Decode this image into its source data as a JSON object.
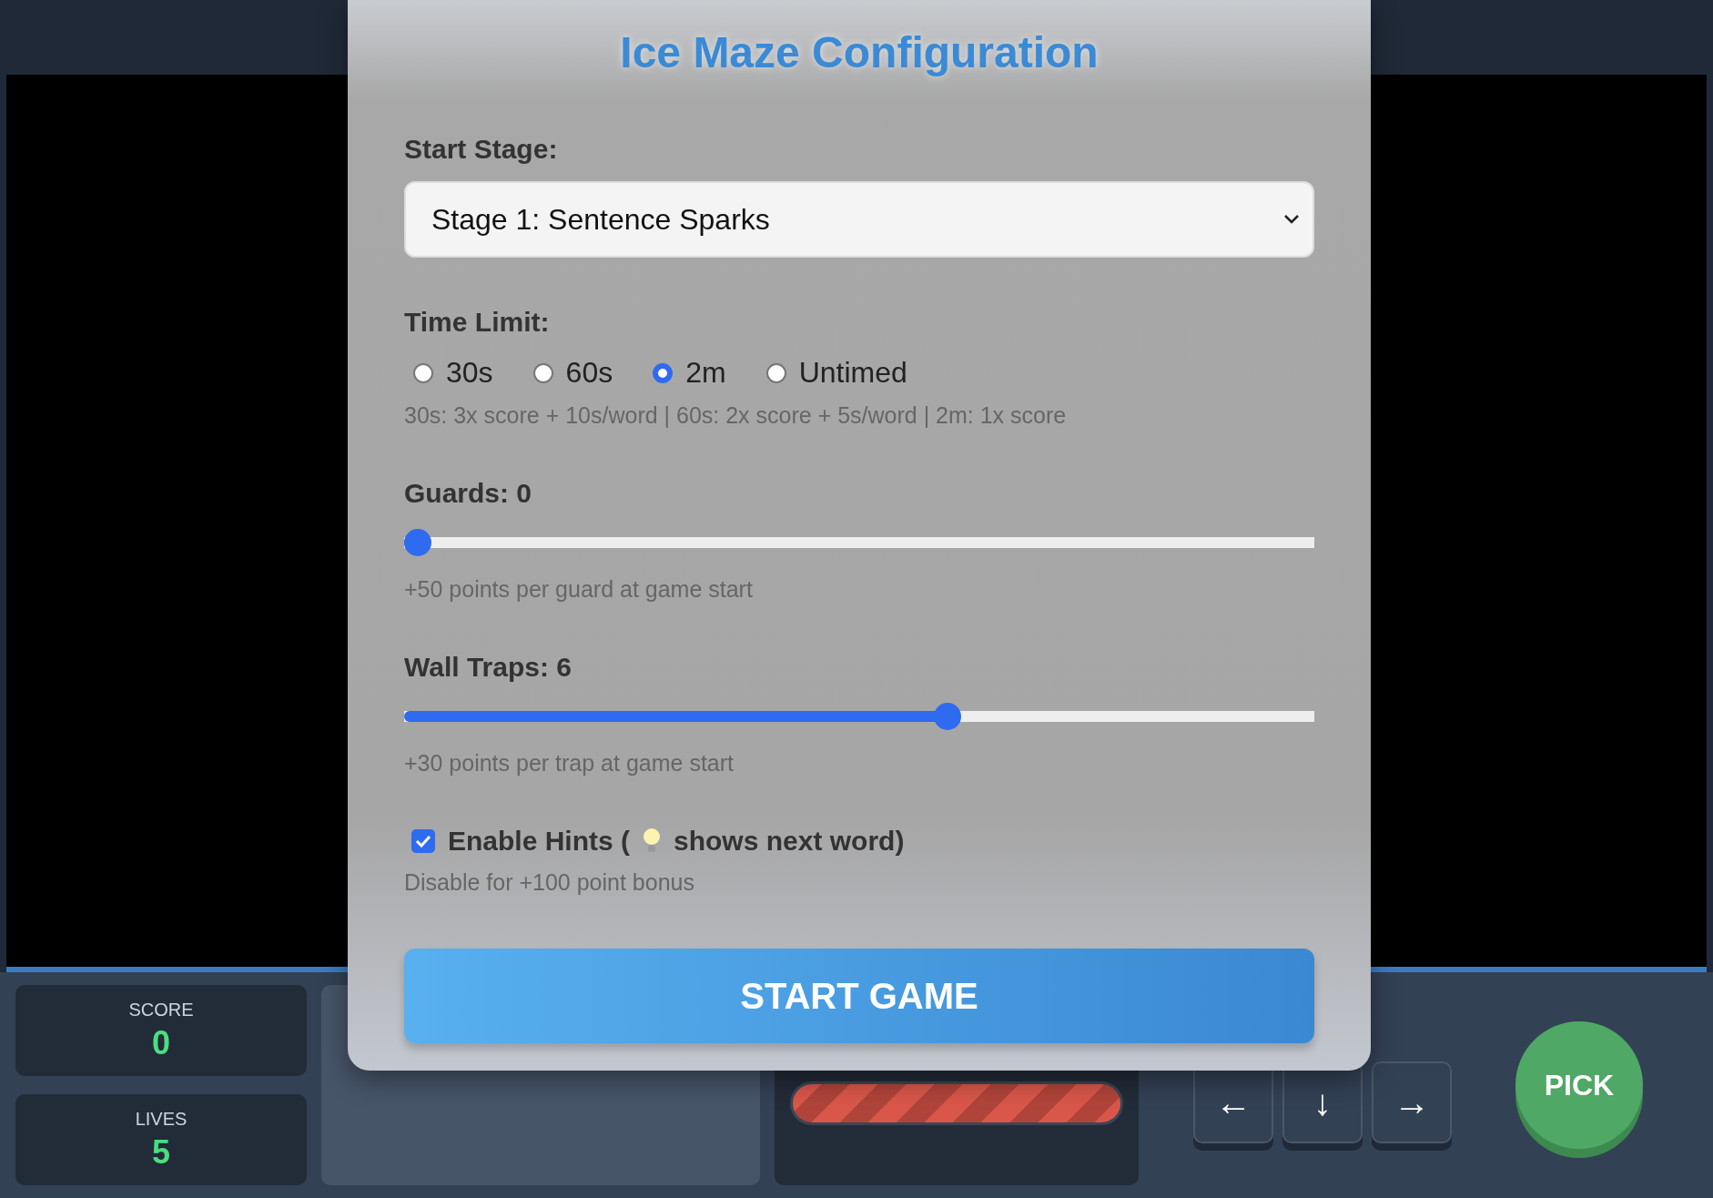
{
  "modal": {
    "title": "Ice Maze Configuration",
    "stage": {
      "label": "Start Stage:",
      "value": "Stage 1: Sentence Sparks"
    },
    "time_limit": {
      "label": "Time Limit:",
      "options": [
        {
          "label": "30s",
          "selected": false
        },
        {
          "label": "60s",
          "selected": false
        },
        {
          "label": "2m",
          "selected": true
        },
        {
          "label": "Untimed",
          "selected": false
        }
      ],
      "note": "30s: 3x score + 10s/word | 60s: 2x score + 5s/word | 2m: 1x score"
    },
    "sliders": [
      {
        "label": "Guards: 0",
        "level": 0,
        "note": "+50 points per guard at game start"
      },
      {
        "label": "Wall Traps: 6",
        "level": 0.6,
        "note": "+30 points per trap at game start"
      }
    ],
    "hints": {
      "label_before": "Enable Hints (",
      "label_after": "shows next word)",
      "checked": true,
      "note": "Disable for +100 point bonus"
    },
    "start_button": "START GAME"
  },
  "hud": {
    "stats": [
      {
        "label": "SCORE",
        "value": "0"
      },
      {
        "label": "LIVES",
        "value": "5"
      }
    ],
    "arrows": [
      "←",
      "↓",
      "→"
    ],
    "pick_button": "PICK"
  }
}
